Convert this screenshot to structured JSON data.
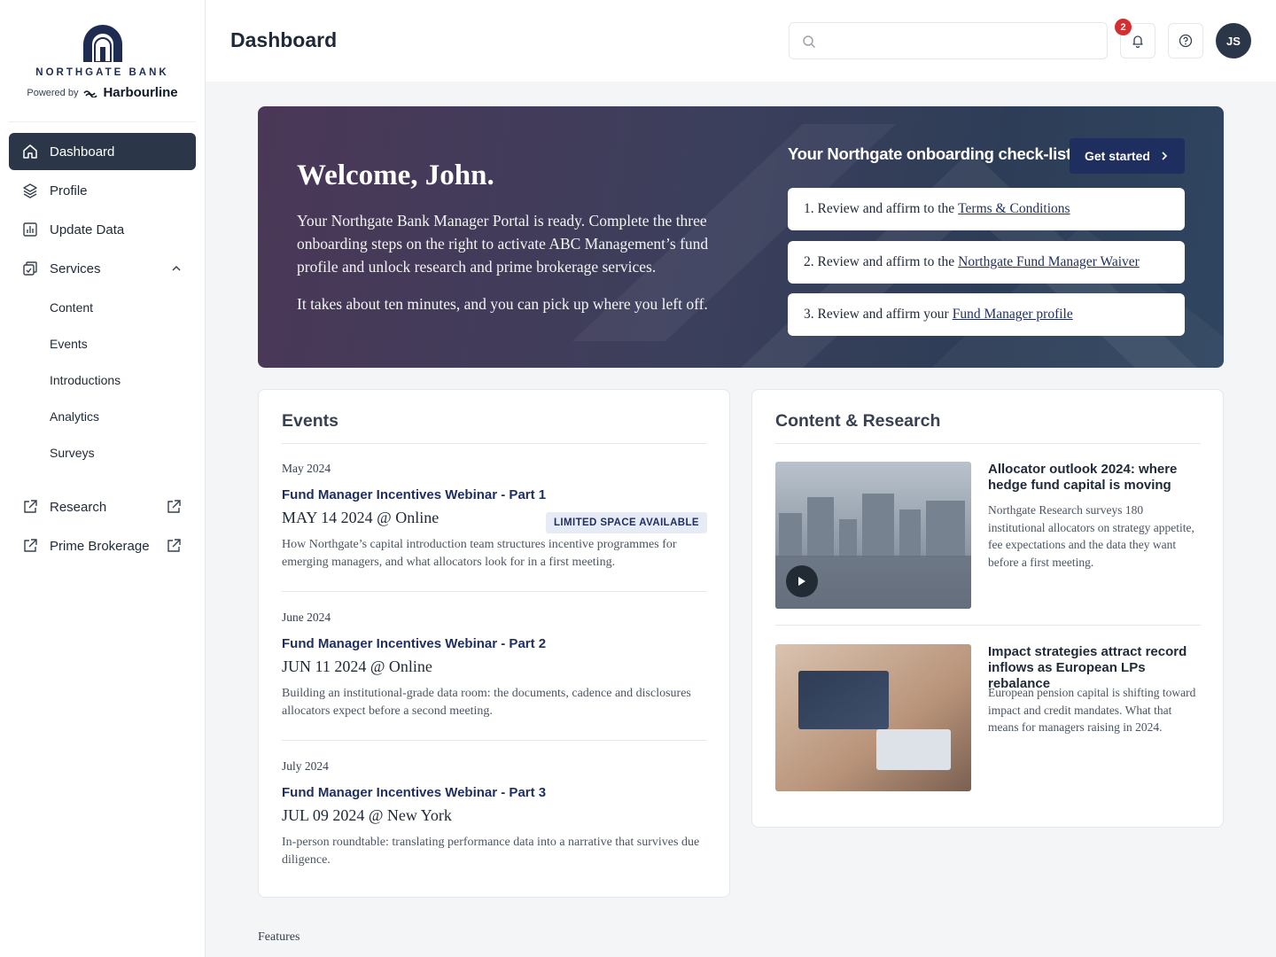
{
  "brand": {
    "name": "NORTHGATE BANK",
    "powered_by": "Powered by",
    "partner": "Harbourline"
  },
  "sidebar": {
    "items": [
      {
        "label": "Dashboard",
        "icon": "home-icon",
        "active": true
      },
      {
        "label": "Profile",
        "icon": "layers-icon"
      },
      {
        "label": "Update Data",
        "icon": "chart-icon"
      },
      {
        "label": "Services",
        "icon": "services-icon",
        "expanded": true
      }
    ],
    "services_sub": [
      {
        "label": "Content"
      },
      {
        "label": "Events"
      },
      {
        "label": "Introductions"
      },
      {
        "label": "Analytics"
      },
      {
        "label": "Surveys"
      }
    ],
    "external": [
      {
        "label": "Research",
        "icon": "external-link-icon"
      },
      {
        "label": "Prime Brokerage",
        "icon": "external-link-icon"
      }
    ]
  },
  "header": {
    "title": "Dashboard",
    "search_placeholder": "",
    "notification_count": "2",
    "avatar_initials": "JS"
  },
  "hero": {
    "title": "Welcome, John.",
    "paragraph1": "Your Northgate Bank Manager Portal is ready. Complete the three onboarding steps on the right to activate ABC Management’s fund profile and unlock research and prime brokerage services.",
    "paragraph2": "It takes about ten minutes, and you can pick up where you left off.",
    "checklist_title": "Your Northgate onboarding check-list",
    "cta": "Get started",
    "checklist": [
      {
        "prefix": "1. Review and affirm to the",
        "link": "Terms & Conditions"
      },
      {
        "prefix": "2. Review and affirm to the",
        "link": "Northgate Fund Manager Waiver"
      },
      {
        "prefix": "3. Review and affirm your",
        "link": "Fund Manager profile"
      }
    ]
  },
  "events": {
    "title": "Events",
    "items": [
      {
        "month": "May 2024",
        "title": "Fund Manager Incentives Webinar - Part 1",
        "date": "MAY 14 2024 @ Online",
        "badge": "LIMITED SPACE AVAILABLE",
        "desc": "How Northgate’s capital introduction team structures incentive programmes for emerging managers, and what allocators look for in a first meeting."
      },
      {
        "month": "June 2024",
        "title": "Fund Manager Incentives Webinar - Part 2",
        "date": "JUN 11 2024 @ Online",
        "desc": "Building an institutional-grade data room: the documents, cadence and disclosures allocators expect before a second meeting."
      },
      {
        "month": "July 2024",
        "title": "Fund Manager Incentives Webinar - Part 3",
        "date": "JUL 09 2024 @ New York",
        "desc": "In-person roundtable: translating performance data into a narrative that survives due diligence."
      }
    ]
  },
  "research": {
    "title": "Content & Research",
    "items": [
      {
        "title": "Allocator outlook 2024: where hedge fund capital is moving",
        "desc": "Northgate Research surveys 180 institutional allocators on strategy appetite, fee expectations and the data they want before a first meeting.",
        "has_video": true
      },
      {
        "title": "Impact strategies attract record inflows as European LPs rebalance",
        "desc": "European pension capital is shifting toward impact and credit mandates. What that means for managers raising in 2024.",
        "has_video": false
      }
    ]
  },
  "footer": {
    "features_label": "Features"
  },
  "colors": {
    "navy": "#1e2e5e",
    "sidebar_active": "#2b3748",
    "badge_red": "#d32f2f"
  }
}
